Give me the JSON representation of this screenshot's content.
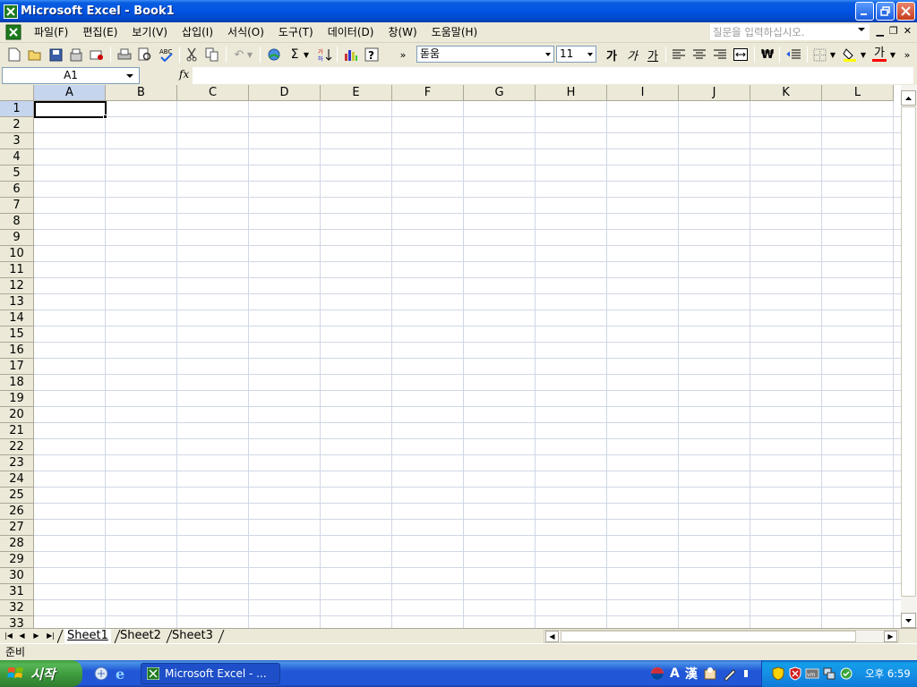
{
  "window": {
    "title": "Microsoft Excel - Book1"
  },
  "menu": {
    "items": [
      "파일(F)",
      "편집(E)",
      "보기(V)",
      "삽입(I)",
      "서식(O)",
      "도구(T)",
      "데이터(D)",
      "창(W)",
      "도움말(H)"
    ],
    "help_placeholder": "질문을 입력하십시오."
  },
  "toolbar": {
    "font_name": "돋움",
    "font_size": "11",
    "bold_label": "가",
    "italic_label": "가",
    "underline_label": "가",
    "font_color_label": "가",
    "sum_label": "Σ",
    "currency_label": "₩"
  },
  "formula_bar": {
    "name_box": "A1",
    "fx_label": "fx",
    "formula": ""
  },
  "sheet": {
    "columns": [
      "A",
      "B",
      "C",
      "D",
      "E",
      "F",
      "G",
      "H",
      "I",
      "J",
      "K",
      "L"
    ],
    "rows": [
      "1",
      "2",
      "3",
      "4",
      "5",
      "6",
      "7",
      "8",
      "9",
      "10",
      "11",
      "12",
      "13",
      "14",
      "15",
      "16",
      "17",
      "18",
      "19",
      "20",
      "21",
      "22",
      "23",
      "24",
      "25",
      "26",
      "27",
      "28",
      "29",
      "30",
      "31",
      "32",
      "33"
    ],
    "selected_cell": "A1"
  },
  "tabs": {
    "sheets": [
      "Sheet1",
      "Sheet2",
      "Sheet3"
    ],
    "active": "Sheet1"
  },
  "status": {
    "text": "준비"
  },
  "taskbar": {
    "start_label": "시작",
    "task_item": "Microsoft Excel - ...",
    "ime_lang": "A",
    "ime_hanja": "漢",
    "clock": "오후 6:59"
  },
  "colors": {
    "titlebar": "#0054e3",
    "selected_header": "#c5d5ee",
    "gridline": "#d0d7e5",
    "excel_green": "#1f7a1f"
  }
}
